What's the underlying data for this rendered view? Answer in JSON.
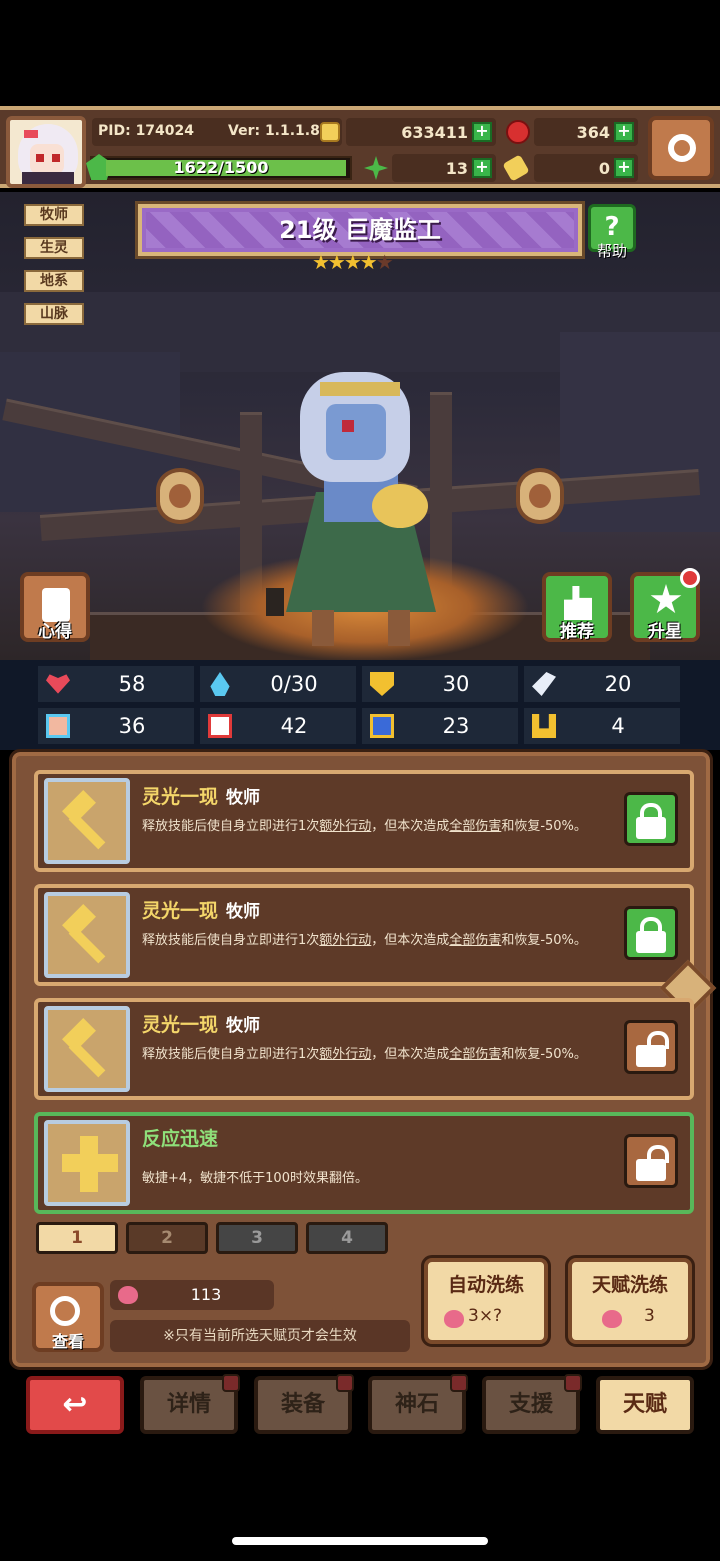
{
  "top": {
    "pid": "PID: 174024",
    "version": "Ver: 1.1.1.8",
    "gold": "633411",
    "gems": "364",
    "exp": "1622/1500",
    "clover": "13",
    "key": "0"
  },
  "scene": {
    "tags": [
      "牧师",
      "生灵",
      "地系",
      "山脉"
    ],
    "title": "21级  巨魔监工",
    "stars_on": "★★★★",
    "stars_off": "★",
    "help": "帮助",
    "left_btn": "心得",
    "recommend_btn": "推荐",
    "upgrade_btn": "升星"
  },
  "stats": {
    "hp": "58",
    "mp": "0/30",
    "def": "30",
    "spd": "20",
    "atk": "36",
    "magic": "42",
    "res": "23",
    "luck": "4"
  },
  "talents": [
    {
      "name": "灵光一现",
      "cls": "牧师",
      "desc_a": "释放技能后使自身立即进行1次",
      "desc_u1": "额外行动",
      "desc_b": "，但本次造成",
      "desc_u2": "全部伤害",
      "desc_c": "和恢复-50%。"
    },
    {
      "name": "灵光一现",
      "cls": "牧师",
      "desc_a": "释放技能后使自身立即进行1次",
      "desc_u1": "额外行动",
      "desc_b": "，但本次造成",
      "desc_u2": "全部伤害",
      "desc_c": "和恢复-50%。"
    },
    {
      "name": "灵光一现",
      "cls": "牧师",
      "desc_a": "释放技能后使自身立即进行1次",
      "desc_u1": "额外行动",
      "desc_b": "，但本次造成",
      "desc_u2": "全部伤害",
      "desc_c": "和恢复-50%。"
    },
    {
      "name": "反应迅速",
      "cls": "",
      "desc_a": "敏捷+4，敏捷不低于100时效果翻倍。",
      "desc_u1": "",
      "desc_b": "",
      "desc_u2": "",
      "desc_c": ""
    }
  ],
  "pages": [
    "1",
    "2",
    "3",
    "4"
  ],
  "panel": {
    "view": "查看",
    "peach_count": "113",
    "note": "※只有当前所选天赋页才会生效",
    "auto_wash": "自动洗练",
    "auto_cost": "3×?",
    "talent_wash": "天赋洗练",
    "talent_cost": "3"
  },
  "nav": {
    "back": "↩",
    "details": "详情",
    "equip": "装备",
    "stone": "神石",
    "support": "支援",
    "talent": "天赋"
  },
  "colors": {
    "accent_gold": "#f4d66a",
    "lock_on": "#4cb848",
    "lock_off": "#a86840",
    "title_purple": "#9a6ac6"
  }
}
